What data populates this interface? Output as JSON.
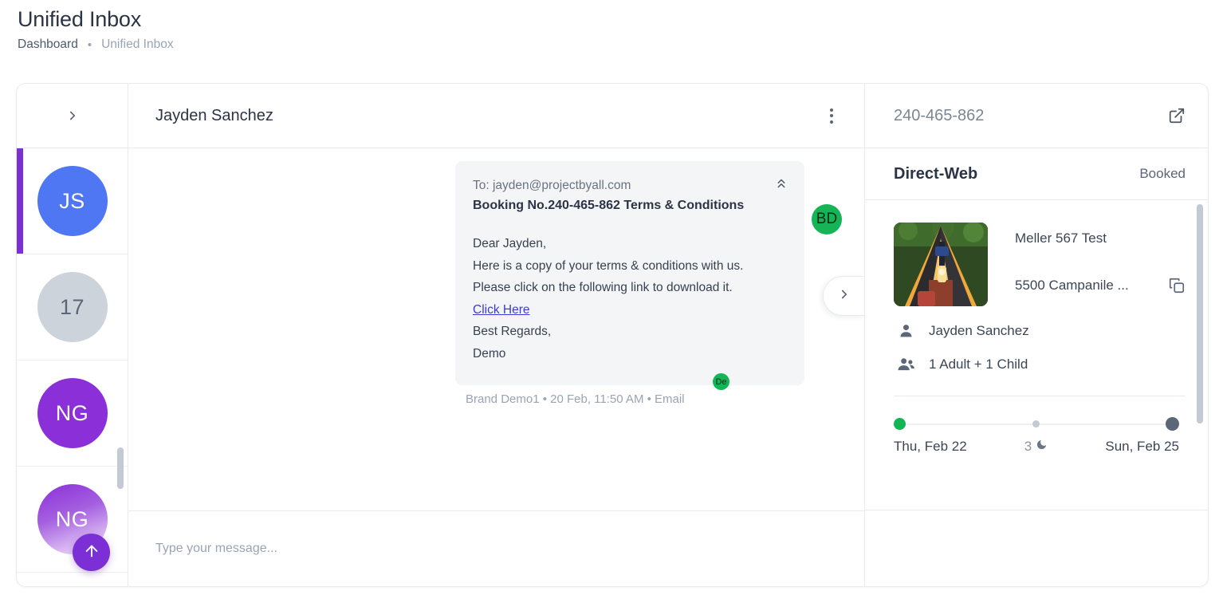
{
  "page": {
    "title": "Unified Inbox",
    "breadcrumb": {
      "root": "Dashboard",
      "separator": "•",
      "current": "Unified Inbox"
    }
  },
  "rail": {
    "expand_icon": "chevron-right-icon",
    "items": [
      {
        "initials": "JS",
        "type": "initials",
        "color": "#4f76f3",
        "active": true
      },
      {
        "initials": "17",
        "type": "count",
        "color": "#ccd3da",
        "active": false
      },
      {
        "initials": "NG",
        "type": "initials",
        "color": "#8b2fd8",
        "active": false
      },
      {
        "initials": "NG",
        "type": "initials-fade",
        "color": "#8b2fd8",
        "active": false
      }
    ],
    "fab_icon": "arrow-up-icon"
  },
  "chat": {
    "contact_name": "Jayden Sanchez",
    "menu_icon": "kebab-menu-icon",
    "side_tab_icon": "chevron-right-icon",
    "message": {
      "to_label": "To: jayden@projectbyall.com",
      "subject": "Booking No.240-465-862 Terms & Conditions",
      "collapse_icon": "chevrons-up-icon",
      "lines": [
        "Dear Jayden,",
        "Here is a copy of your terms & conditions with us.",
        "Please click on the following link to download it."
      ],
      "link_text": "Click Here",
      "closing": [
        "Best Regards,",
        "Demo"
      ],
      "sender_initials": "BD",
      "sender_color": "#14b457",
      "badge_initials": "De",
      "meta": "Brand Demo1 • 20 Feb, 11:50 AM • Email"
    },
    "composer": {
      "placeholder": "Type your message...",
      "value": ""
    }
  },
  "booking": {
    "booking_no": "240-465-862",
    "open_icon": "external-link-icon",
    "channel": "Direct-Web",
    "status": "Booked",
    "property_name": "Meller 567 Test",
    "address": "5500 Campanile ...",
    "copy_icon": "copy-icon",
    "guest_icon": "person-icon",
    "guest_name": "Jayden Sanchez",
    "occupancy_icon": "people-icon",
    "occupancy": "1 Adult + 1 Child",
    "check_in": "Thu, Feb 22",
    "nights": "3",
    "nights_icon": "moon-icon",
    "check_out": "Sun, Feb 25"
  },
  "colors": {
    "accent_purple": "#7b2fd4",
    "avatar_blue": "#4f76f3",
    "green": "#14b457",
    "link": "#3a3ad8",
    "text": "#2b3445",
    "muted": "#9aa4b2"
  }
}
